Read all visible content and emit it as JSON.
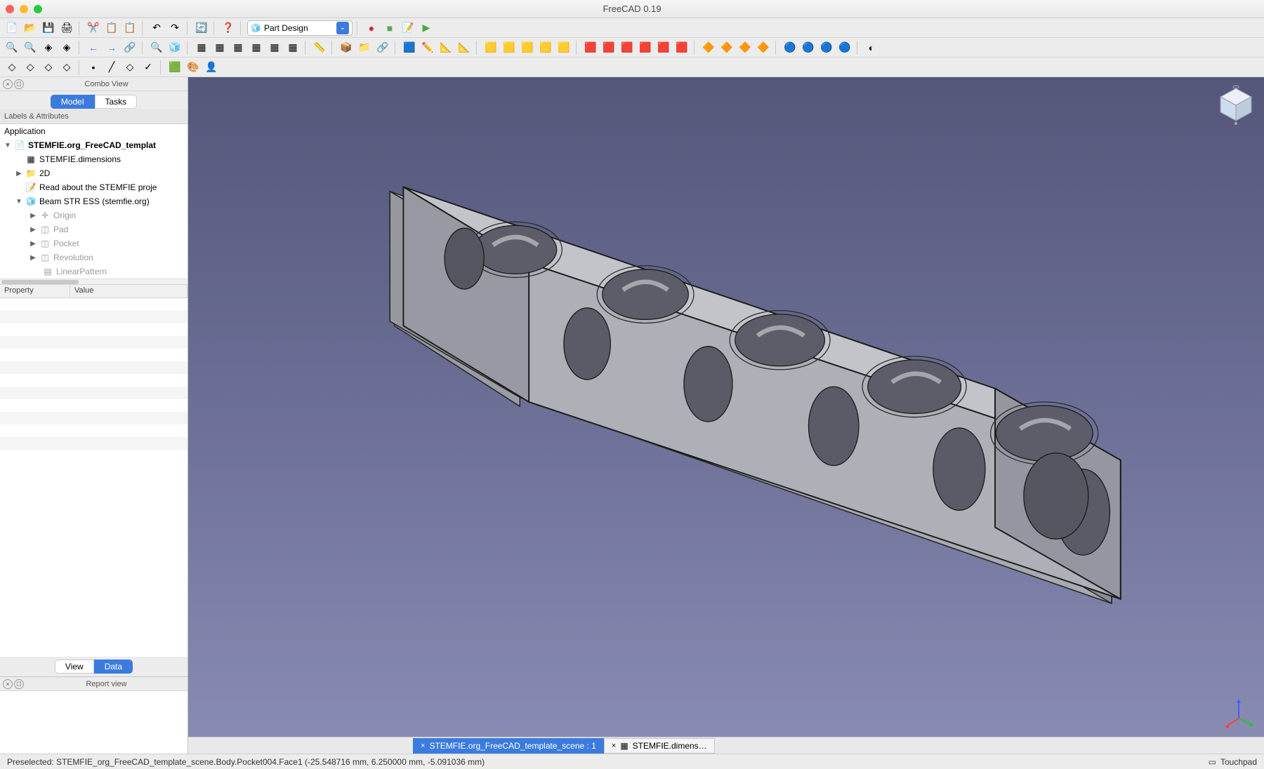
{
  "window": {
    "title": "FreeCAD 0.19"
  },
  "workbench": {
    "selected": "Part Design"
  },
  "combo": {
    "title": "Combo View",
    "tabs": {
      "model": "Model",
      "tasks": "Tasks"
    },
    "labels_attrs": "Labels & Attributes",
    "tree": {
      "app": "Application",
      "doc": "STEMFIE.org_FreeCAD_templat",
      "dims": "STEMFIE.dimensions",
      "folder2d": "2D",
      "read": "Read about the STEMFIE proje",
      "beam": "Beam STR ESS (stemfie.org)",
      "origin": "Origin",
      "pad": "Pad",
      "pocket": "Pocket",
      "revolution": "Revolution",
      "linpat": "LinearPattern"
    },
    "prop": {
      "property": "Property",
      "value": "Value",
      "view": "View",
      "data": "Data"
    }
  },
  "report": {
    "title": "Report view"
  },
  "doc_tabs": {
    "active": "STEMFIE.org_FreeCAD_template_scene : 1",
    "second": "STEMFIE.dimens…"
  },
  "status": {
    "text": "Preselected: STEMFIE_org_FreeCAD_template_scene.Body.Pocket004.Face1 (-25.548716 mm, 6.250000 mm, -5.091036 mm)",
    "nav": "Touchpad"
  }
}
